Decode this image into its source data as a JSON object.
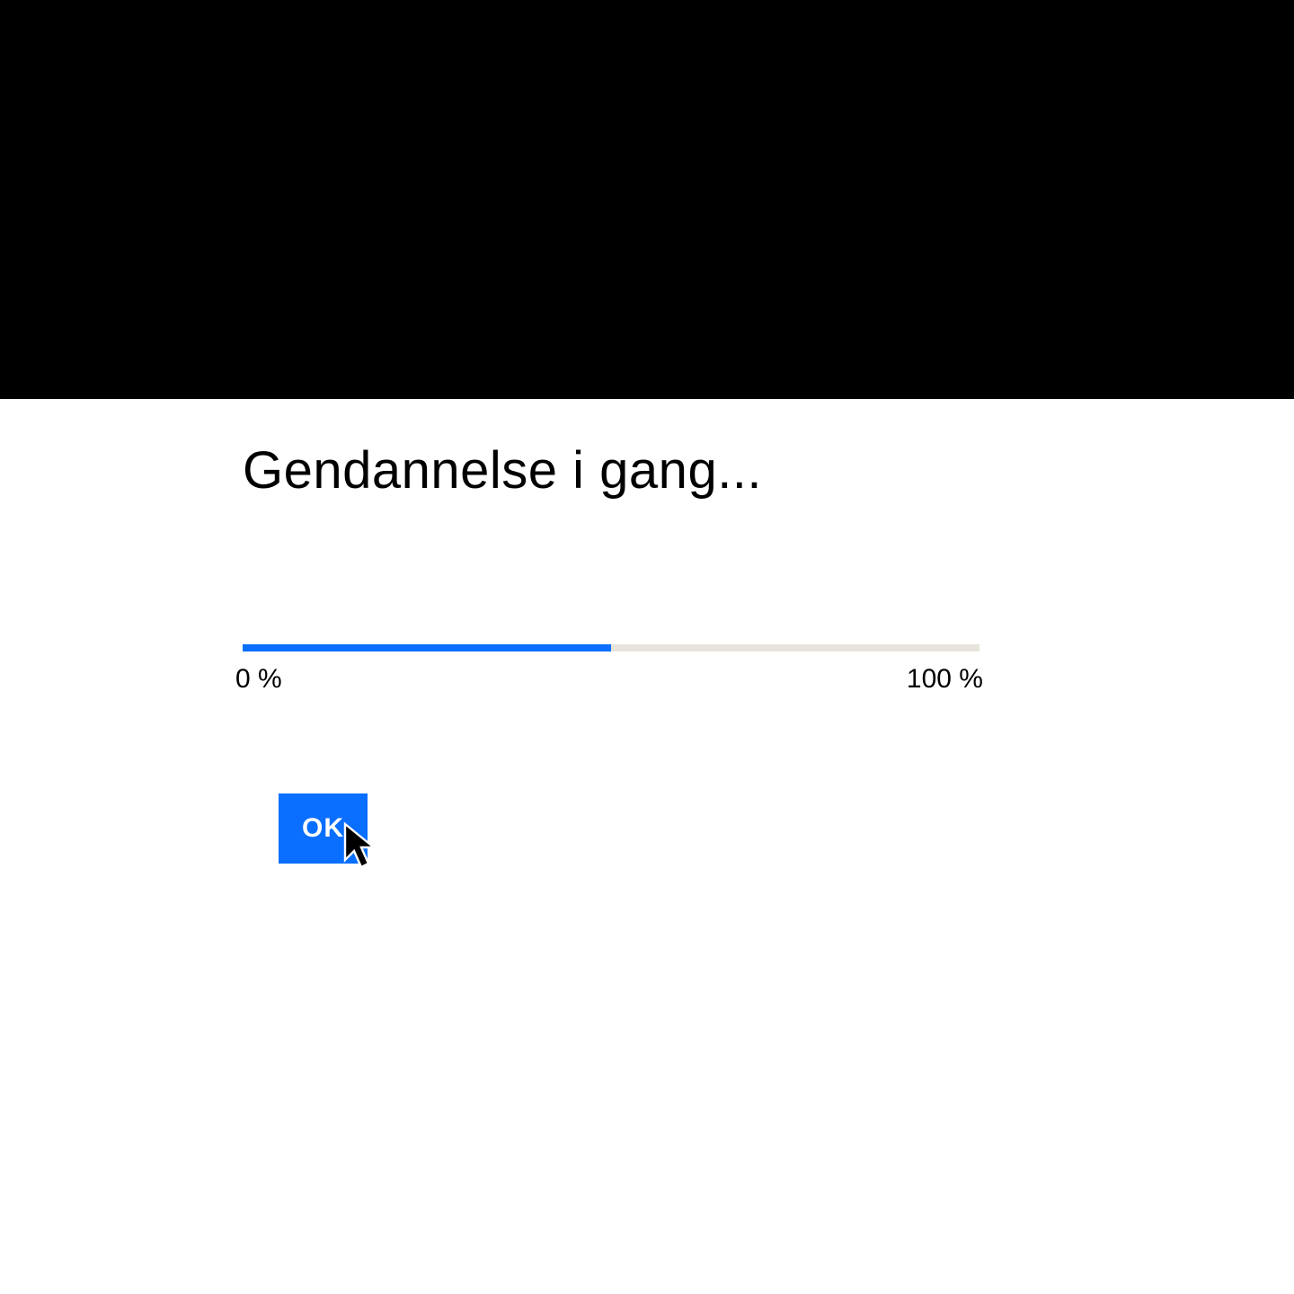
{
  "dialog": {
    "title": "Gendannelse i gang...",
    "progress": {
      "min_label": "0 %",
      "max_label": "100 %",
      "percent": 50,
      "track_color": "#e8e4dd",
      "fill_color": "#0a6fff"
    },
    "ok_label": "OK"
  }
}
